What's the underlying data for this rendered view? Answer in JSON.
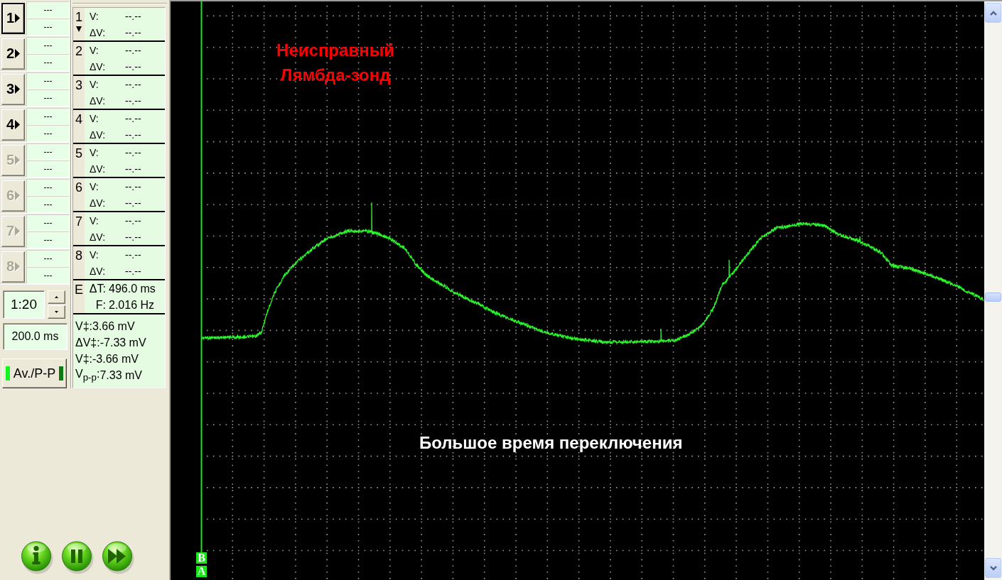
{
  "channels": [
    {
      "button_label": "1",
      "selected": true,
      "disabled": false,
      "values": [
        "---",
        "---"
      ],
      "number": "1",
      "trigger": true,
      "v_label": "V:",
      "v_value": "--.--",
      "dv_label": "ΔV:",
      "dv_value": "--.--"
    },
    {
      "button_label": "2",
      "selected": false,
      "disabled": false,
      "values": [
        "---",
        "---"
      ],
      "number": "2",
      "trigger": false,
      "v_label": "V:",
      "v_value": "--.--",
      "dv_label": "ΔV:",
      "dv_value": "--.--"
    },
    {
      "button_label": "3",
      "selected": false,
      "disabled": false,
      "values": [
        "---",
        "---"
      ],
      "number": "3",
      "trigger": false,
      "v_label": "V:",
      "v_value": "--.--",
      "dv_label": "ΔV:",
      "dv_value": "--.--"
    },
    {
      "button_label": "4",
      "selected": false,
      "disabled": false,
      "values": [
        "---",
        "---"
      ],
      "number": "4",
      "trigger": false,
      "v_label": "V:",
      "v_value": "--.--",
      "dv_label": "ΔV:",
      "dv_value": "--.--"
    },
    {
      "button_label": "5",
      "selected": false,
      "disabled": true,
      "values": [
        "---",
        "---"
      ],
      "number": "5",
      "trigger": false,
      "v_label": "V:",
      "v_value": "--.--",
      "dv_label": "ΔV:",
      "dv_value": "--.--"
    },
    {
      "button_label": "6",
      "selected": false,
      "disabled": true,
      "values": [
        "---",
        "---"
      ],
      "number": "6",
      "trigger": false,
      "v_label": "V:",
      "v_value": "--.--",
      "dv_label": "ΔV:",
      "dv_value": "--.--"
    },
    {
      "button_label": "7",
      "selected": false,
      "disabled": true,
      "values": [
        "---",
        "---"
      ],
      "number": "7",
      "trigger": false,
      "v_label": "V:",
      "v_value": "--.--",
      "dv_label": "ΔV:",
      "dv_value": "--.--"
    },
    {
      "button_label": "8",
      "selected": false,
      "disabled": true,
      "values": [
        "---",
        "---"
      ],
      "number": "8",
      "trigger": false,
      "v_label": "V:",
      "v_value": "--.--",
      "dv_label": "ΔV:",
      "dv_value": "--.--"
    }
  ],
  "timebase": {
    "ratio": "1:20",
    "time": "200.0 ms"
  },
  "mode_button": {
    "label": "Av./P-P",
    "indicators": [
      {
        "on": true
      },
      {
        "on": false
      }
    ]
  },
  "time_measure": {
    "label": "E",
    "rows": [
      {
        "label": "ΔT:",
        "value": "496.0 ms"
      },
      {
        "label": "F:",
        "value": "2.016 Hz"
      }
    ]
  },
  "voltage_readings": [
    {
      "label": "V‡:",
      "value": "3.66 mV"
    },
    {
      "label": "ΔV‡:",
      "value": "-7.33 mV"
    },
    {
      "label": "V‡:",
      "value": "-3.66 mV"
    },
    {
      "label": "V$_{p-p}$:",
      "value": "7.33 mV"
    }
  ],
  "plot": {
    "title": "Неисправный Лямбда-зонд",
    "caption": "Большое время переключения",
    "cursor_markers": [
      "B",
      "A"
    ]
  }
}
